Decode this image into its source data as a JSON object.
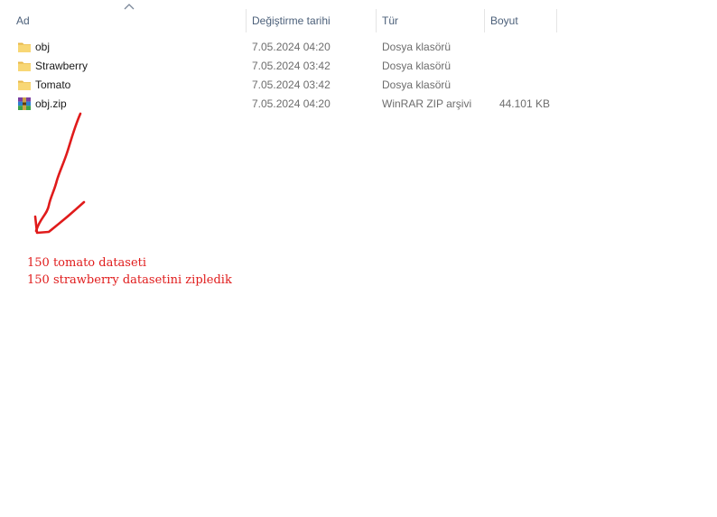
{
  "columns": {
    "name": "Ad",
    "date": "Değiştirme tarihi",
    "type": "Tür",
    "size": "Boyut"
  },
  "sort": {
    "column": "name",
    "direction": "ascending",
    "icon": "sort-up-icon"
  },
  "files": [
    {
      "name": "obj",
      "date": "7.05.2024 04:20",
      "type": "Dosya klasörü",
      "size": "",
      "icon": "folder-icon"
    },
    {
      "name": "Strawberry",
      "date": "7.05.2024 03:42",
      "type": "Dosya klasörü",
      "size": "",
      "icon": "folder-icon"
    },
    {
      "name": "Tomato",
      "date": "7.05.2024 03:42",
      "type": "Dosya klasörü",
      "size": "",
      "icon": "folder-icon"
    },
    {
      "name": "obj.zip",
      "date": "7.05.2024 04:20",
      "type": "WinRAR ZIP arşivi",
      "size": "44.101 KB",
      "icon": "winrar-zip-icon"
    }
  ],
  "annotation": {
    "line1": "150 tomato dataseti",
    "line2": "150 strawberry datasetini zipledik",
    "color": "#e01b1b"
  },
  "colors": {
    "header_text": "#4c607a",
    "folder": "#f8d775",
    "secondary_text": "#6d6d6d"
  }
}
